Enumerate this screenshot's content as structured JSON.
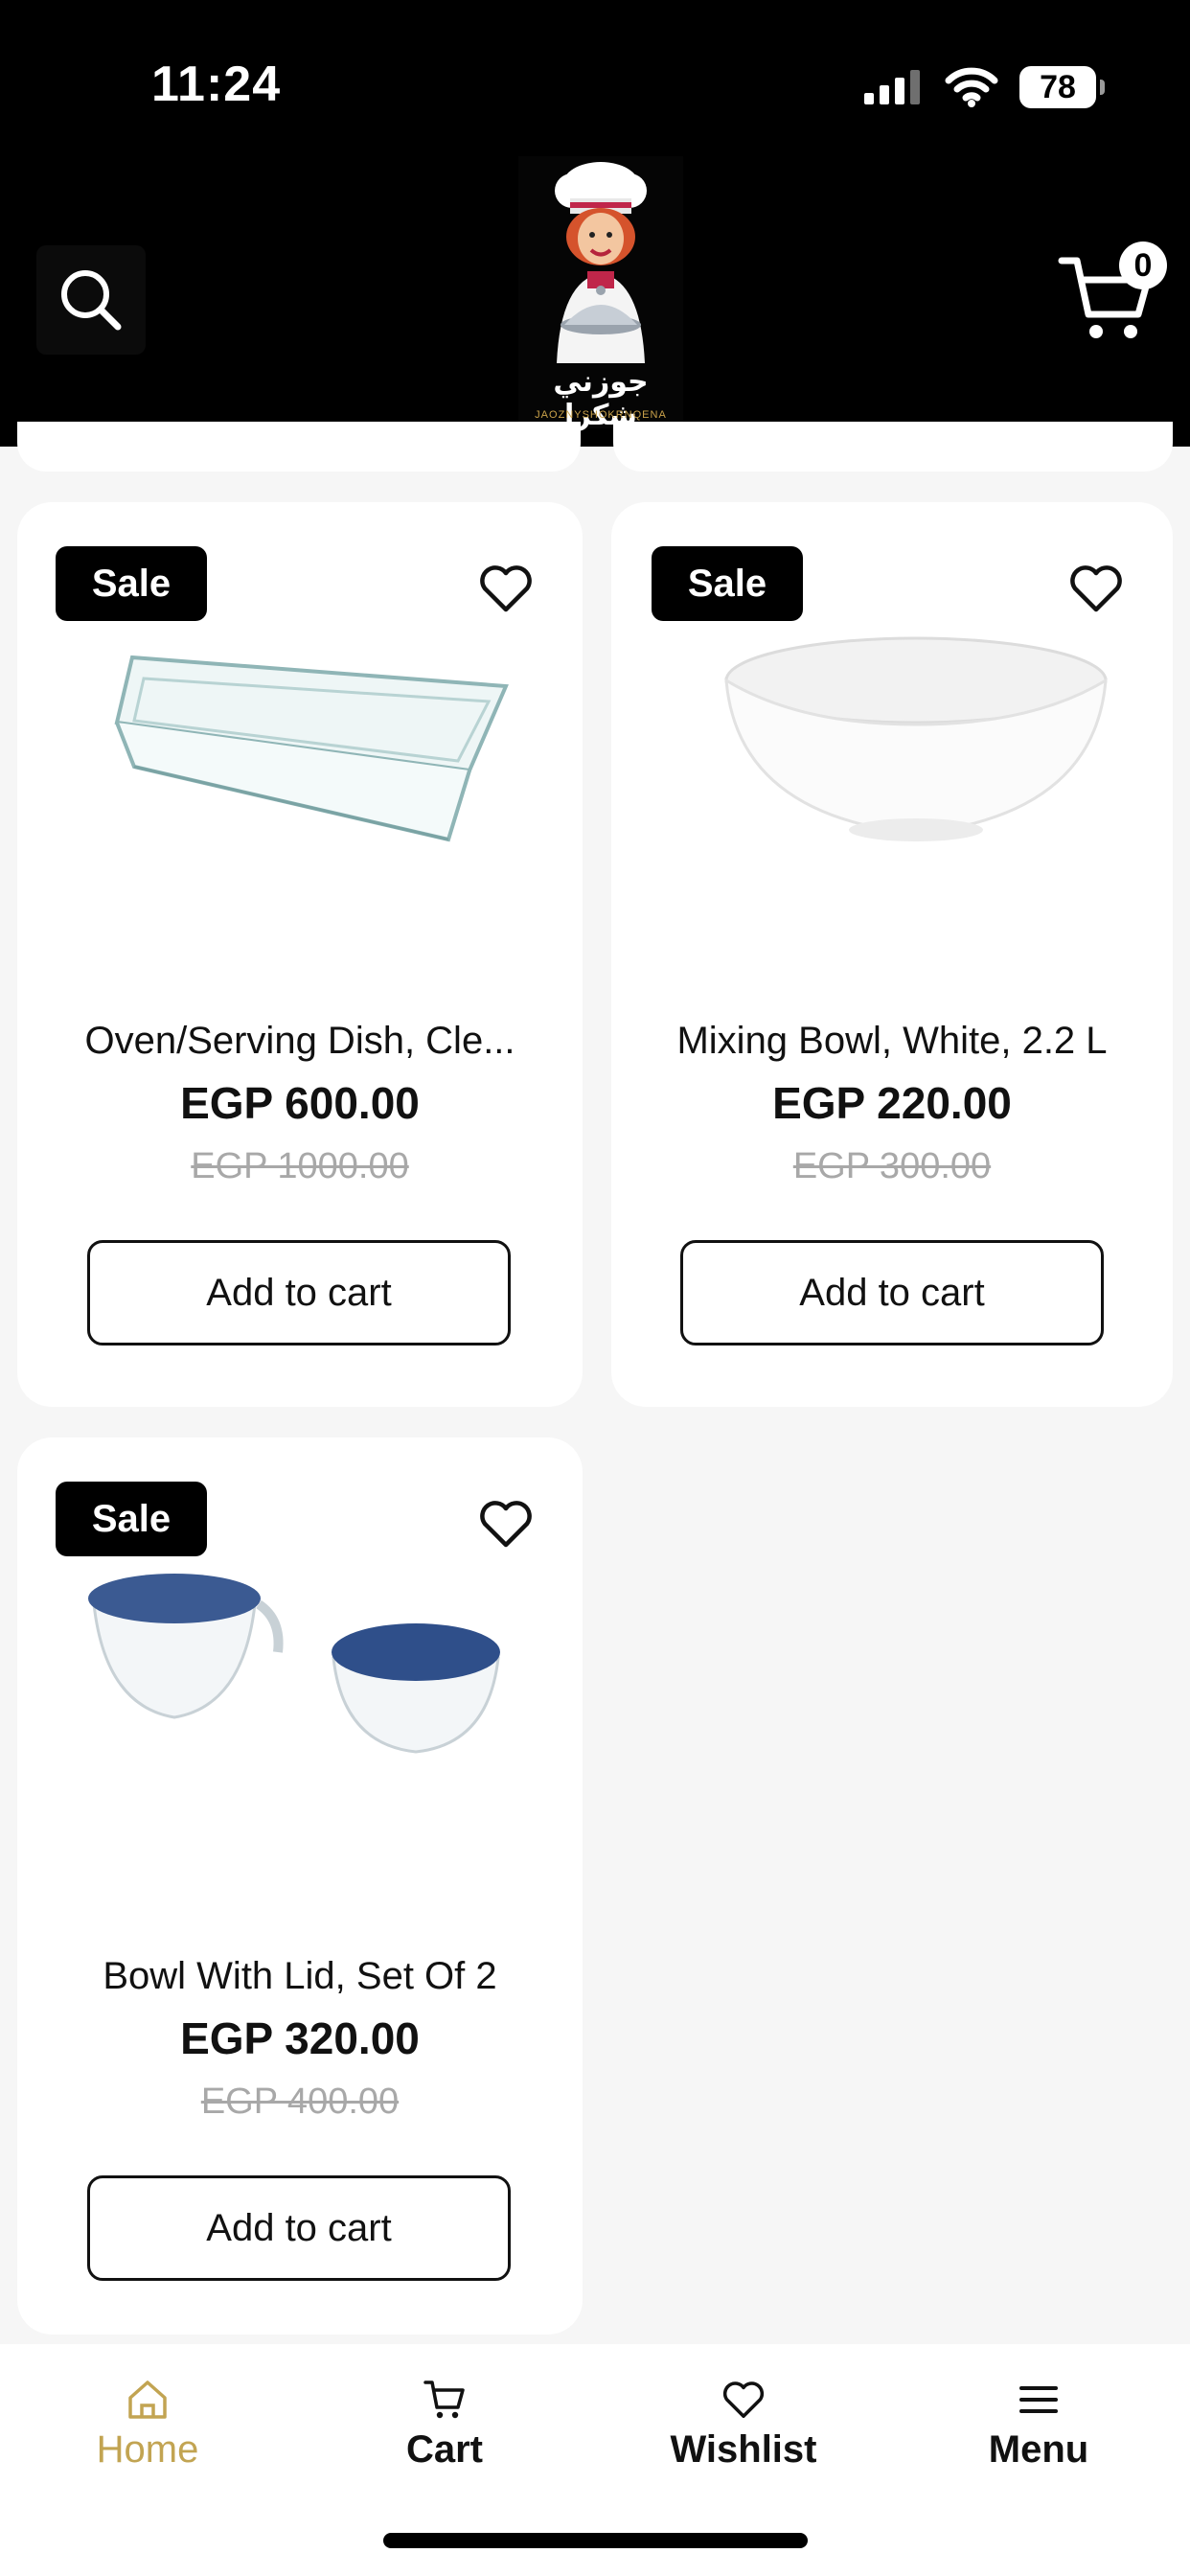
{
  "status_bar": {
    "time": "11:24",
    "battery": "78"
  },
  "header": {
    "logo_arabic": "جوزني شكرا",
    "logo_tagline": "JAOZNYSHOKRNQENA",
    "cart_count": "0"
  },
  "products": [
    {
      "badge": "Sale",
      "name": "Oven/Serving Dish, Cle...",
      "price": "EGP 600.00",
      "old_price": "EGP 1000.00",
      "button": "Add to cart"
    },
    {
      "badge": "Sale",
      "name": "Mixing Bowl, White, 2.2 L",
      "price": "EGP 220.00",
      "old_price": "EGP 300.00",
      "button": "Add to cart"
    },
    {
      "badge": "Sale",
      "name": "Bowl With Lid, Set Of 2",
      "price": "EGP 320.00",
      "old_price": "EGP 400.00",
      "button": "Add to cart"
    }
  ],
  "nav": {
    "home": "Home",
    "cart": "Cart",
    "wishlist": "Wishlist",
    "menu": "Menu",
    "active_color": "#c2a452"
  }
}
